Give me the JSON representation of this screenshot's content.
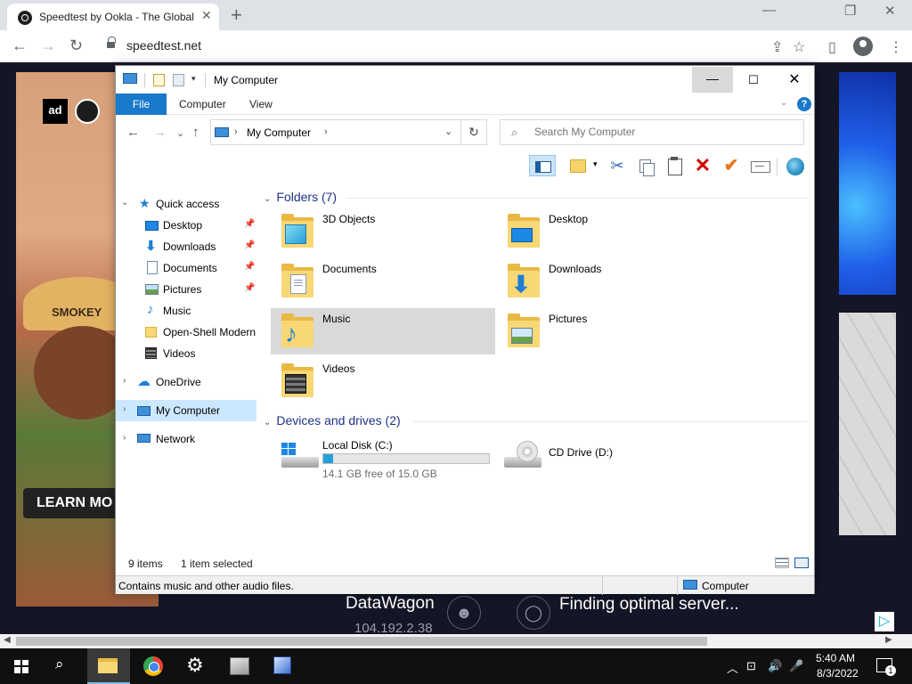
{
  "browser": {
    "tab_title": "Speedtest by Ookla - The Global",
    "tab_close": "✕",
    "new_tab": "+",
    "url": "speedtest.net",
    "win_min": "—",
    "win_restore": "❐",
    "win_close": "✕",
    "back": "←",
    "forward": "→",
    "reload": "↻",
    "share_icon": "⇪",
    "star_icon": "☆",
    "sidepanel_icon": "▯",
    "menu_icon": "⋮"
  },
  "page": {
    "ad_left_logo": "ad",
    "ad_left_hat_text": "SMOKEY",
    "ad_left_cta": "LEARN MO",
    "isp_name": "DataWagon",
    "ip_address": "104.192.2.38",
    "server_status": "Finding optimal server...",
    "user_icon": "person-icon",
    "globe_icon": "globe-icon",
    "adchoices": "▷"
  },
  "explorer": {
    "title": "My Computer",
    "qa_dropdown": "▾",
    "min": "—",
    "max": "☐",
    "close": "✕",
    "ribbon_tabs": {
      "file": "File",
      "computer": "Computer",
      "view": "View"
    },
    "ribbon_expand": "⌄",
    "help": "?",
    "nav": {
      "back": "←",
      "forward": "→",
      "recent": "⌄",
      "up": "↑"
    },
    "address": {
      "sep": "›",
      "crumb": "My Computer",
      "sep2": "›",
      "dropdown": "⌄",
      "refresh": "↻"
    },
    "search_placeholder": "Search My Computer",
    "search_icon": "⌕",
    "cmd": {
      "dropdown": "▾",
      "cut": "✂",
      "delete": "✕",
      "check": "✔"
    },
    "nav_pane": {
      "quick_access": "Quick access",
      "pinned": [
        {
          "label": "Desktop",
          "icon": "desktop-icon",
          "pin": "📌"
        },
        {
          "label": "Downloads",
          "icon": "downloads-icon",
          "pin": "📌"
        },
        {
          "label": "Documents",
          "icon": "documents-icon",
          "pin": "📌"
        },
        {
          "label": "Pictures",
          "icon": "pictures-icon",
          "pin": "📌"
        }
      ],
      "music": "Music",
      "openshell": "Open-Shell Modern",
      "videos": "Videos",
      "onedrive": "OneDrive",
      "mycomputer": "My Computer",
      "network": "Network",
      "chev_down": "⌄",
      "chev_right": "›",
      "star": "★",
      "down_arrow": "⬇",
      "note": "♪",
      "cloud": "☁"
    },
    "folders_header": "Folders (7)",
    "folders": [
      {
        "name": "3D Objects"
      },
      {
        "name": "Desktop"
      },
      {
        "name": "Documents"
      },
      {
        "name": "Downloads"
      },
      {
        "name": "Music"
      },
      {
        "name": "Pictures"
      },
      {
        "name": "Videos"
      }
    ],
    "drives_header": "Devices and drives (2)",
    "drives": [
      {
        "name": "Local Disk (C:)",
        "free_text": "14.1 GB free of 15.0 GB",
        "used_fraction": 0.06
      },
      {
        "name": "CD Drive (D:)"
      }
    ],
    "caret": "⌄",
    "down_arrow": "⬇",
    "note": "♪",
    "status_items": "9 items",
    "status_selected": "1 item selected",
    "info_text": "Contains music and other audio files.",
    "info_location": "Computer"
  },
  "taskbar": {
    "search": "⌕",
    "gear": "⚙",
    "tray_chevron": "︿",
    "tray_network": "⊡",
    "tray_volume": "🔊",
    "tray_mic": "🎤",
    "time": "5:40 AM",
    "date": "8/3/2022",
    "notifications": "1"
  }
}
